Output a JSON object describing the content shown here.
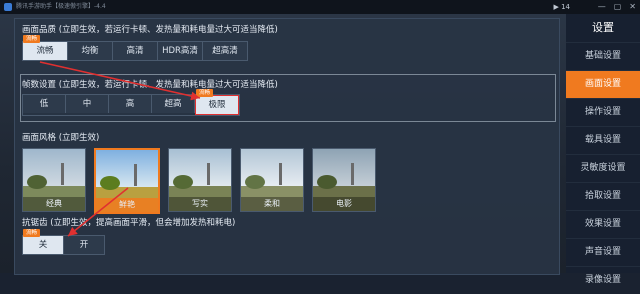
{
  "window": {
    "title": "腾讯手游助手【极速傲引擎】-4.4",
    "signal": "▶ 14",
    "controls": [
      "—",
      "▢",
      "✕"
    ]
  },
  "quality": {
    "title": "画面品质 (立即生效，若运行卡顿、发热量和耗电量过大可适当降低)",
    "tag": "流畅",
    "options": [
      "流畅",
      "均衡",
      "高清",
      "HDR高清",
      "超高清"
    ],
    "selected": "流畅"
  },
  "fps": {
    "title": "帧数设置 (立即生效，若运行卡顿、发热量和耗电量过大可适当降低)",
    "tag": "流畅",
    "options": [
      "低",
      "中",
      "高",
      "超高",
      "极限"
    ],
    "selected": "极限"
  },
  "style": {
    "title": "画面风格 (立即生效)",
    "tag": "流畅",
    "options": [
      "经典",
      "鲜艳",
      "写实",
      "柔和",
      "电影"
    ],
    "selected": "鲜艳"
  },
  "aa": {
    "title": "抗锯齿 (立即生效，提高画面平滑，但会增加发热和耗电)",
    "tag": "流畅",
    "options": [
      "关",
      "开"
    ],
    "selected": "关"
  },
  "sidebar": {
    "header": "设置",
    "items": [
      "基础设置",
      "画面设置",
      "操作设置",
      "载具设置",
      "灵敏度设置",
      "拾取设置",
      "效果设置",
      "声音设置",
      "录像设置"
    ],
    "selected": "画面设置"
  },
  "colors": {
    "accent": "#f07a1f",
    "arrow": "#e03030"
  }
}
